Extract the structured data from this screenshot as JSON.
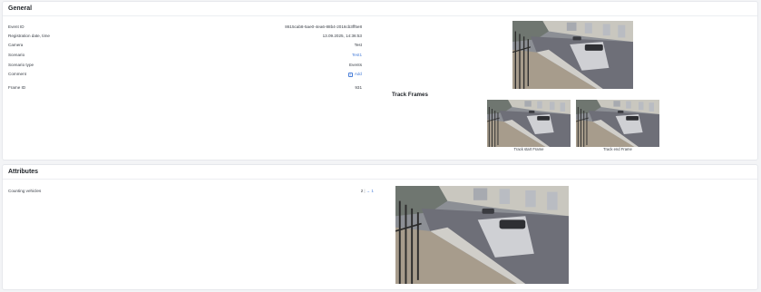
{
  "general": {
    "title": "General",
    "fields": [
      {
        "label": "Event ID",
        "value": "8615cab8-5ae0-4ea6-88b4-2016cb3ff5e8",
        "link": false
      },
      {
        "label": "Registration date, time",
        "value": "13.09.2025, 14:36:53",
        "link": false
      },
      {
        "label": "Camera",
        "value": "Test",
        "link": false
      },
      {
        "label": "Scenario",
        "value": "Test1",
        "link": true
      },
      {
        "label": "Scenario type",
        "value": "Events",
        "link": false
      }
    ],
    "comment": {
      "label": "Comment",
      "add_label": "Add",
      "plus": "+"
    },
    "frame": {
      "label": "Frame ID",
      "value": "931"
    },
    "track_frames_title": "Track Frames",
    "track_start_caption": "Track start Frame",
    "track_end_caption": "Track end Frame"
  },
  "attributes": {
    "title": "Attributes",
    "counting": {
      "label": "Counting vehicles",
      "value_main": "2",
      "separator": "|",
      "value_link": "→ 1"
    }
  },
  "colors": {
    "link": "#4a7fd9",
    "text": "#3b4048",
    "panel_bg": "#ffffff",
    "page_bg": "#f3f4f6"
  },
  "icons": {
    "add": "plus-square-icon"
  }
}
